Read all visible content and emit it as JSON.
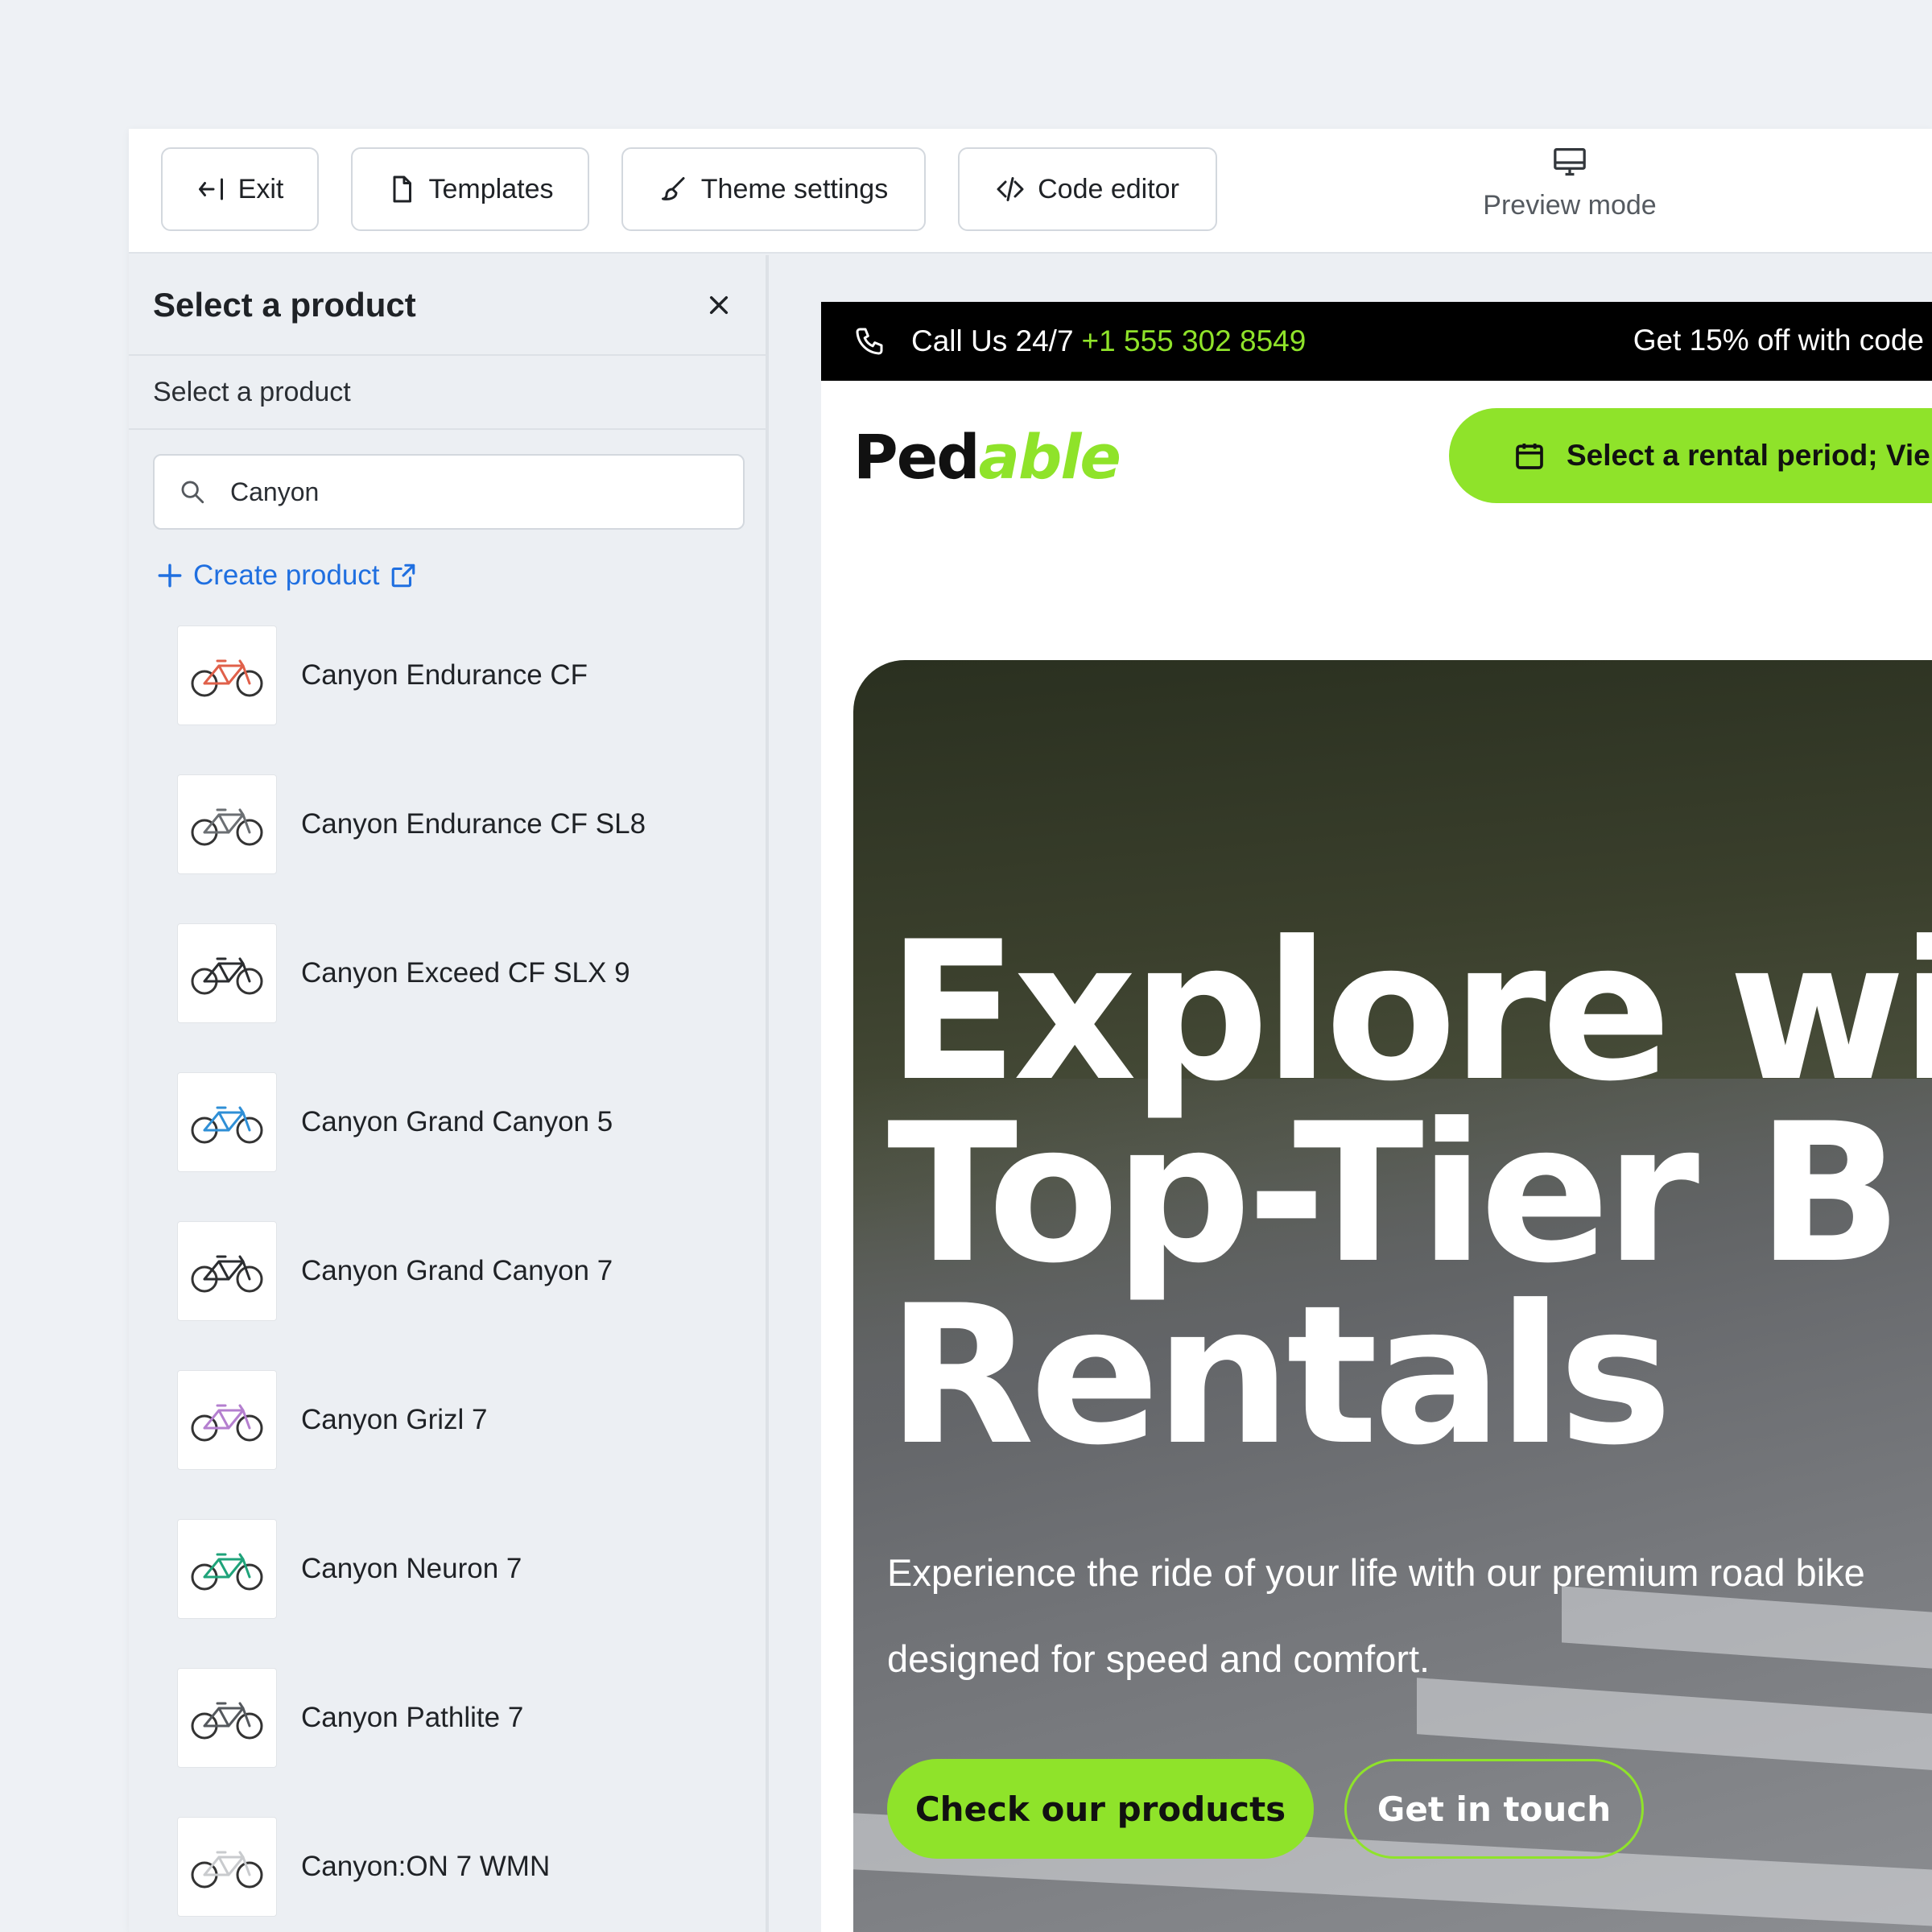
{
  "toolbar": {
    "exit_label": "Exit",
    "templates_label": "Templates",
    "theme_label": "Theme settings",
    "code_label": "Code editor",
    "preview_label": "Preview mode"
  },
  "panel": {
    "title": "Select a product",
    "subtitle": "Select a product",
    "search_value": "Canyon",
    "create_label": "Create product",
    "products": [
      {
        "name": "Canyon Endurance CF",
        "color": "#e0604a"
      },
      {
        "name": "Canyon Endurance CF SL8",
        "color": "#6b6f73"
      },
      {
        "name": "Canyon Exceed CF SLX 9",
        "color": "#2b2d30"
      },
      {
        "name": "Canyon Grand Canyon 5",
        "color": "#2f8fd6"
      },
      {
        "name": "Canyon Grand Canyon 7",
        "color": "#2b2d30"
      },
      {
        "name": "Canyon Grizl 7",
        "color": "#b47fcf"
      },
      {
        "name": "Canyon Neuron 7",
        "color": "#1fa37a"
      },
      {
        "name": "Canyon Pathlite 7",
        "color": "#55595e"
      },
      {
        "name": "Canyon:ON 7 WMN",
        "color": "#c9cbce"
      }
    ]
  },
  "site": {
    "call_prefix": "Call Us 24/7",
    "phone": "+1 555 302 8549",
    "promo": "Get 15% off with code",
    "logo_ped": "Ped",
    "logo_able": "able",
    "rental_label": "Select a rental period; Vie",
    "hero_title": "Explore wit\nTop-Tier B\nRentals",
    "hero_text": "Experience the ride of your life with our premium road bike designed for speed and comfort.",
    "cta_primary": "Check our products",
    "cta_secondary": "Get in touch",
    "accent": "#8fe32a"
  }
}
